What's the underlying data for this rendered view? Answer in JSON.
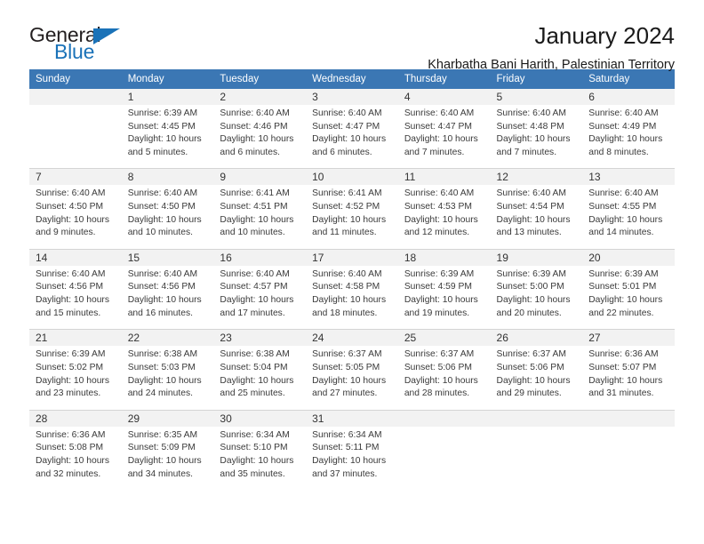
{
  "brand": {
    "word_one": "General",
    "word_two": "Blue",
    "triangle_color": "#1a72b8",
    "text_color": "#231f20"
  },
  "header": {
    "title": "January 2024",
    "subtitle": "Kharbatha Bani Harith, Palestinian Territory",
    "header_bg": "#3b77b4",
    "daynum_bg": "#f2f2f2"
  },
  "columns": [
    "Sunday",
    "Monday",
    "Tuesday",
    "Wednesday",
    "Thursday",
    "Friday",
    "Saturday"
  ],
  "weeks": [
    {
      "days": [
        {
          "num": "",
          "lines": []
        },
        {
          "num": "1",
          "lines": [
            "Sunrise: 6:39 AM",
            "Sunset: 4:45 PM",
            "Daylight: 10 hours",
            "and 5 minutes."
          ]
        },
        {
          "num": "2",
          "lines": [
            "Sunrise: 6:40 AM",
            "Sunset: 4:46 PM",
            "Daylight: 10 hours",
            "and 6 minutes."
          ]
        },
        {
          "num": "3",
          "lines": [
            "Sunrise: 6:40 AM",
            "Sunset: 4:47 PM",
            "Daylight: 10 hours",
            "and 6 minutes."
          ]
        },
        {
          "num": "4",
          "lines": [
            "Sunrise: 6:40 AM",
            "Sunset: 4:47 PM",
            "Daylight: 10 hours",
            "and 7 minutes."
          ]
        },
        {
          "num": "5",
          "lines": [
            "Sunrise: 6:40 AM",
            "Sunset: 4:48 PM",
            "Daylight: 10 hours",
            "and 7 minutes."
          ]
        },
        {
          "num": "6",
          "lines": [
            "Sunrise: 6:40 AM",
            "Sunset: 4:49 PM",
            "Daylight: 10 hours",
            "and 8 minutes."
          ]
        }
      ]
    },
    {
      "days": [
        {
          "num": "7",
          "lines": [
            "Sunrise: 6:40 AM",
            "Sunset: 4:50 PM",
            "Daylight: 10 hours",
            "and 9 minutes."
          ]
        },
        {
          "num": "8",
          "lines": [
            "Sunrise: 6:40 AM",
            "Sunset: 4:50 PM",
            "Daylight: 10 hours",
            "and 10 minutes."
          ]
        },
        {
          "num": "9",
          "lines": [
            "Sunrise: 6:41 AM",
            "Sunset: 4:51 PM",
            "Daylight: 10 hours",
            "and 10 minutes."
          ]
        },
        {
          "num": "10",
          "lines": [
            "Sunrise: 6:41 AM",
            "Sunset: 4:52 PM",
            "Daylight: 10 hours",
            "and 11 minutes."
          ]
        },
        {
          "num": "11",
          "lines": [
            "Sunrise: 6:40 AM",
            "Sunset: 4:53 PM",
            "Daylight: 10 hours",
            "and 12 minutes."
          ]
        },
        {
          "num": "12",
          "lines": [
            "Sunrise: 6:40 AM",
            "Sunset: 4:54 PM",
            "Daylight: 10 hours",
            "and 13 minutes."
          ]
        },
        {
          "num": "13",
          "lines": [
            "Sunrise: 6:40 AM",
            "Sunset: 4:55 PM",
            "Daylight: 10 hours",
            "and 14 minutes."
          ]
        }
      ]
    },
    {
      "days": [
        {
          "num": "14",
          "lines": [
            "Sunrise: 6:40 AM",
            "Sunset: 4:56 PM",
            "Daylight: 10 hours",
            "and 15 minutes."
          ]
        },
        {
          "num": "15",
          "lines": [
            "Sunrise: 6:40 AM",
            "Sunset: 4:56 PM",
            "Daylight: 10 hours",
            "and 16 minutes."
          ]
        },
        {
          "num": "16",
          "lines": [
            "Sunrise: 6:40 AM",
            "Sunset: 4:57 PM",
            "Daylight: 10 hours",
            "and 17 minutes."
          ]
        },
        {
          "num": "17",
          "lines": [
            "Sunrise: 6:40 AM",
            "Sunset: 4:58 PM",
            "Daylight: 10 hours",
            "and 18 minutes."
          ]
        },
        {
          "num": "18",
          "lines": [
            "Sunrise: 6:39 AM",
            "Sunset: 4:59 PM",
            "Daylight: 10 hours",
            "and 19 minutes."
          ]
        },
        {
          "num": "19",
          "lines": [
            "Sunrise: 6:39 AM",
            "Sunset: 5:00 PM",
            "Daylight: 10 hours",
            "and 20 minutes."
          ]
        },
        {
          "num": "20",
          "lines": [
            "Sunrise: 6:39 AM",
            "Sunset: 5:01 PM",
            "Daylight: 10 hours",
            "and 22 minutes."
          ]
        }
      ]
    },
    {
      "days": [
        {
          "num": "21",
          "lines": [
            "Sunrise: 6:39 AM",
            "Sunset: 5:02 PM",
            "Daylight: 10 hours",
            "and 23 minutes."
          ]
        },
        {
          "num": "22",
          "lines": [
            "Sunrise: 6:38 AM",
            "Sunset: 5:03 PM",
            "Daylight: 10 hours",
            "and 24 minutes."
          ]
        },
        {
          "num": "23",
          "lines": [
            "Sunrise: 6:38 AM",
            "Sunset: 5:04 PM",
            "Daylight: 10 hours",
            "and 25 minutes."
          ]
        },
        {
          "num": "24",
          "lines": [
            "Sunrise: 6:37 AM",
            "Sunset: 5:05 PM",
            "Daylight: 10 hours",
            "and 27 minutes."
          ]
        },
        {
          "num": "25",
          "lines": [
            "Sunrise: 6:37 AM",
            "Sunset: 5:06 PM",
            "Daylight: 10 hours",
            "and 28 minutes."
          ]
        },
        {
          "num": "26",
          "lines": [
            "Sunrise: 6:37 AM",
            "Sunset: 5:06 PM",
            "Daylight: 10 hours",
            "and 29 minutes."
          ]
        },
        {
          "num": "27",
          "lines": [
            "Sunrise: 6:36 AM",
            "Sunset: 5:07 PM",
            "Daylight: 10 hours",
            "and 31 minutes."
          ]
        }
      ]
    },
    {
      "days": [
        {
          "num": "28",
          "lines": [
            "Sunrise: 6:36 AM",
            "Sunset: 5:08 PM",
            "Daylight: 10 hours",
            "and 32 minutes."
          ]
        },
        {
          "num": "29",
          "lines": [
            "Sunrise: 6:35 AM",
            "Sunset: 5:09 PM",
            "Daylight: 10 hours",
            "and 34 minutes."
          ]
        },
        {
          "num": "30",
          "lines": [
            "Sunrise: 6:34 AM",
            "Sunset: 5:10 PM",
            "Daylight: 10 hours",
            "and 35 minutes."
          ]
        },
        {
          "num": "31",
          "lines": [
            "Sunrise: 6:34 AM",
            "Sunset: 5:11 PM",
            "Daylight: 10 hours",
            "and 37 minutes."
          ]
        },
        {
          "num": "",
          "lines": []
        },
        {
          "num": "",
          "lines": []
        },
        {
          "num": "",
          "lines": []
        }
      ]
    }
  ]
}
